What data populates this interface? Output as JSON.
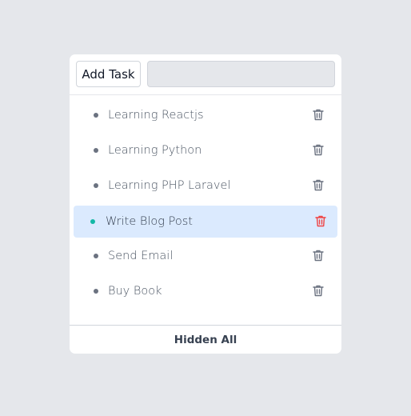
{
  "header": {
    "add_button_label": "Add Task",
    "input_value": "",
    "input_placeholder": ""
  },
  "tasks": [
    {
      "label": "Learning Reactjs",
      "active": false
    },
    {
      "label": "Learning Python",
      "active": false
    },
    {
      "label": "Learning PHP Laravel",
      "active": false
    },
    {
      "label": "Write Blog Post",
      "active": true
    },
    {
      "label": "Send Email",
      "active": false
    },
    {
      "label": "Buy Book",
      "active": false
    }
  ],
  "footer": {
    "hide_button_label": "Hidden All"
  },
  "colors": {
    "page_background": "#e5e7eb",
    "active_row": "#dbeafe",
    "active_bullet": "#14b8a6",
    "active_trash": "#ef4444",
    "trash": "#6b7280"
  },
  "icons": {
    "delete": "trash-icon",
    "bullet": "bullet-icon"
  }
}
